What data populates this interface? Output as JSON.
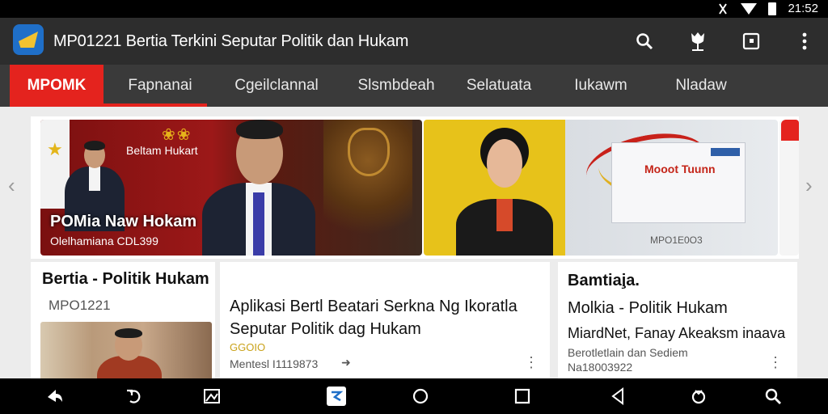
{
  "status_bar": {
    "time": "21:52"
  },
  "app_bar": {
    "title": "MP01221 Bertia Terkini Seputar Politik dan Hukam",
    "actions": [
      "search-icon",
      "tulip-icon",
      "crop-icon",
      "more-vert-icon"
    ]
  },
  "tabs": [
    {
      "label": "MPOMK",
      "active": true
    },
    {
      "label": "Fapnanai",
      "active": false
    },
    {
      "label": "Cgeilclannal",
      "active": false
    },
    {
      "label": "Slsmbdeah",
      "active": false
    },
    {
      "label": "Selatuata",
      "active": false
    },
    {
      "label": "Iukawm",
      "active": false
    },
    {
      "label": "Nladaw",
      "active": false
    }
  ],
  "carousel": {
    "slide1": {
      "headline": "Beltam Hukart",
      "caption": "POMia Naw Hokam",
      "subcaption": "Olelhamiana CDL399"
    },
    "slide2": {
      "box_label": "Mooot Tuunn",
      "footer": "MPO1E0O3"
    }
  },
  "cards": [
    {
      "title": "Bertia - Politik Hukam",
      "meta": "MPO1221"
    },
    {
      "title_line1": "Aplikasi Bertl Beatari Serkna Ng Ikoratla",
      "title_line2": "Seputar Politik dag Hukam",
      "badge": "GGOIO",
      "meta": "Mentesl I1119873"
    },
    {
      "heading": "Bamtiai̧a.",
      "title": "Molkia - Politik Hukam",
      "subtitle": "MiardNet, Fanay Akeaksm inaava",
      "meta_line1": "Berotletlain dan Sediem",
      "meta_line2": "Na18003922"
    }
  ],
  "colors": {
    "accent": "#e4231e",
    "appbar": "#2d2d2d",
    "tabs": "#3a3a3a"
  }
}
